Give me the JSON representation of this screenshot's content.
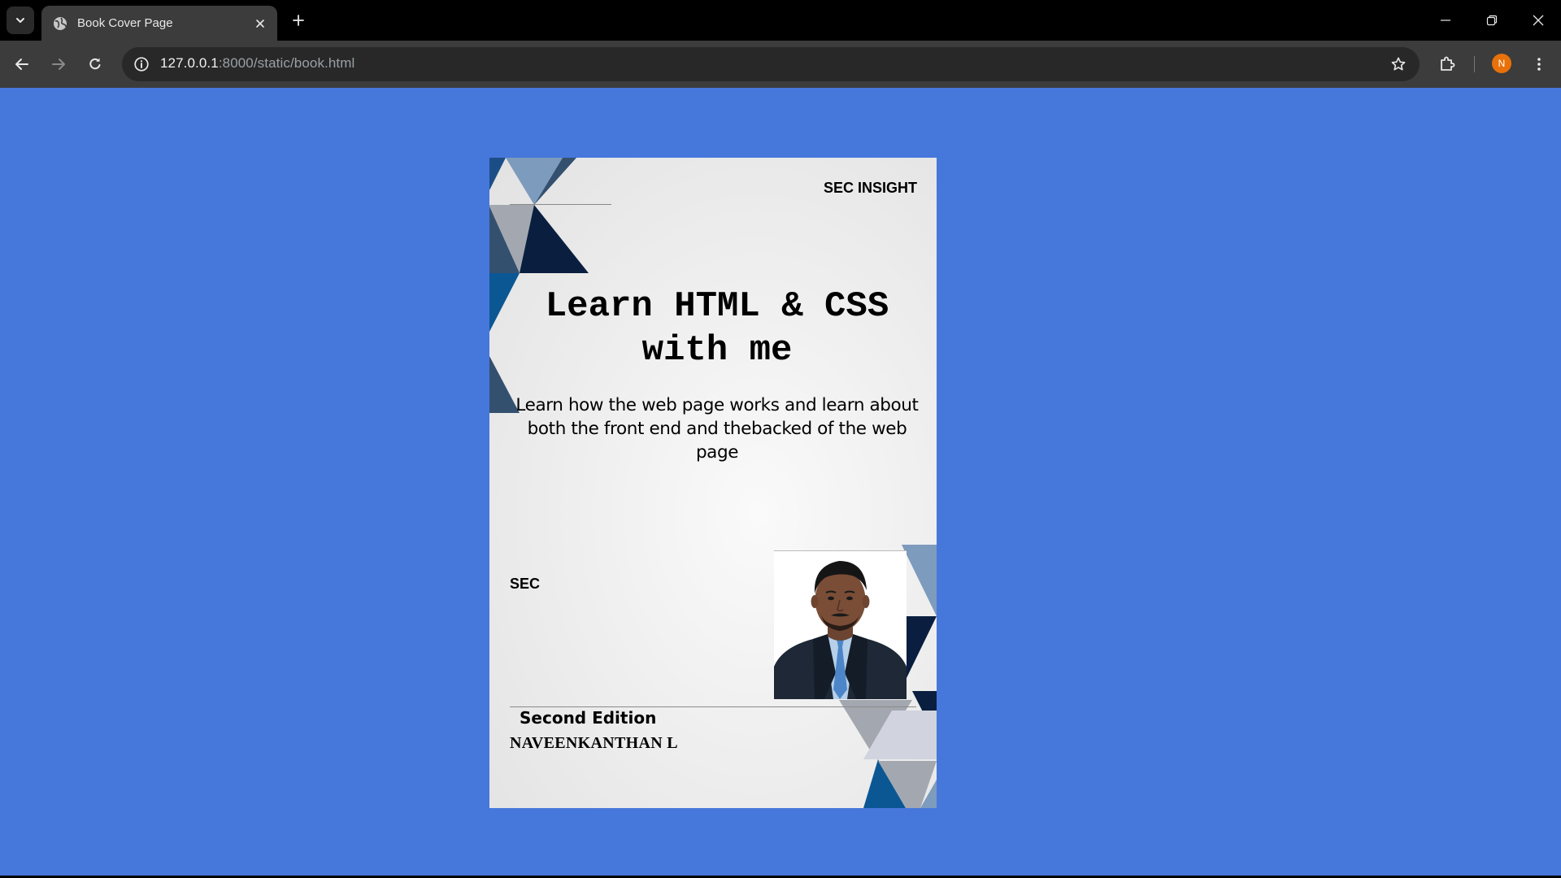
{
  "browser": {
    "tab_title": "Book Cover Page",
    "url_host": "127.0.0.1",
    "url_path": ":8000/static/book.html",
    "profile_initial": "N"
  },
  "page": {
    "background_color": "#4677db"
  },
  "book": {
    "publisher": "SEC INSIGHT",
    "title_line1": "Learn HTML & CSS",
    "title_line2": "with me",
    "subtitle": "Learn how the web page works and learn about both the front end and thebacked of the web page",
    "imprint": "SEC",
    "edition": "Second Edition",
    "author": "NAVEENKANTHAN L",
    "shape_colors": [
      "#7d9bbd",
      "#34506f",
      "#a3a8b0",
      "#0a1f3f",
      "#0b5794",
      "#d1d3de"
    ]
  }
}
